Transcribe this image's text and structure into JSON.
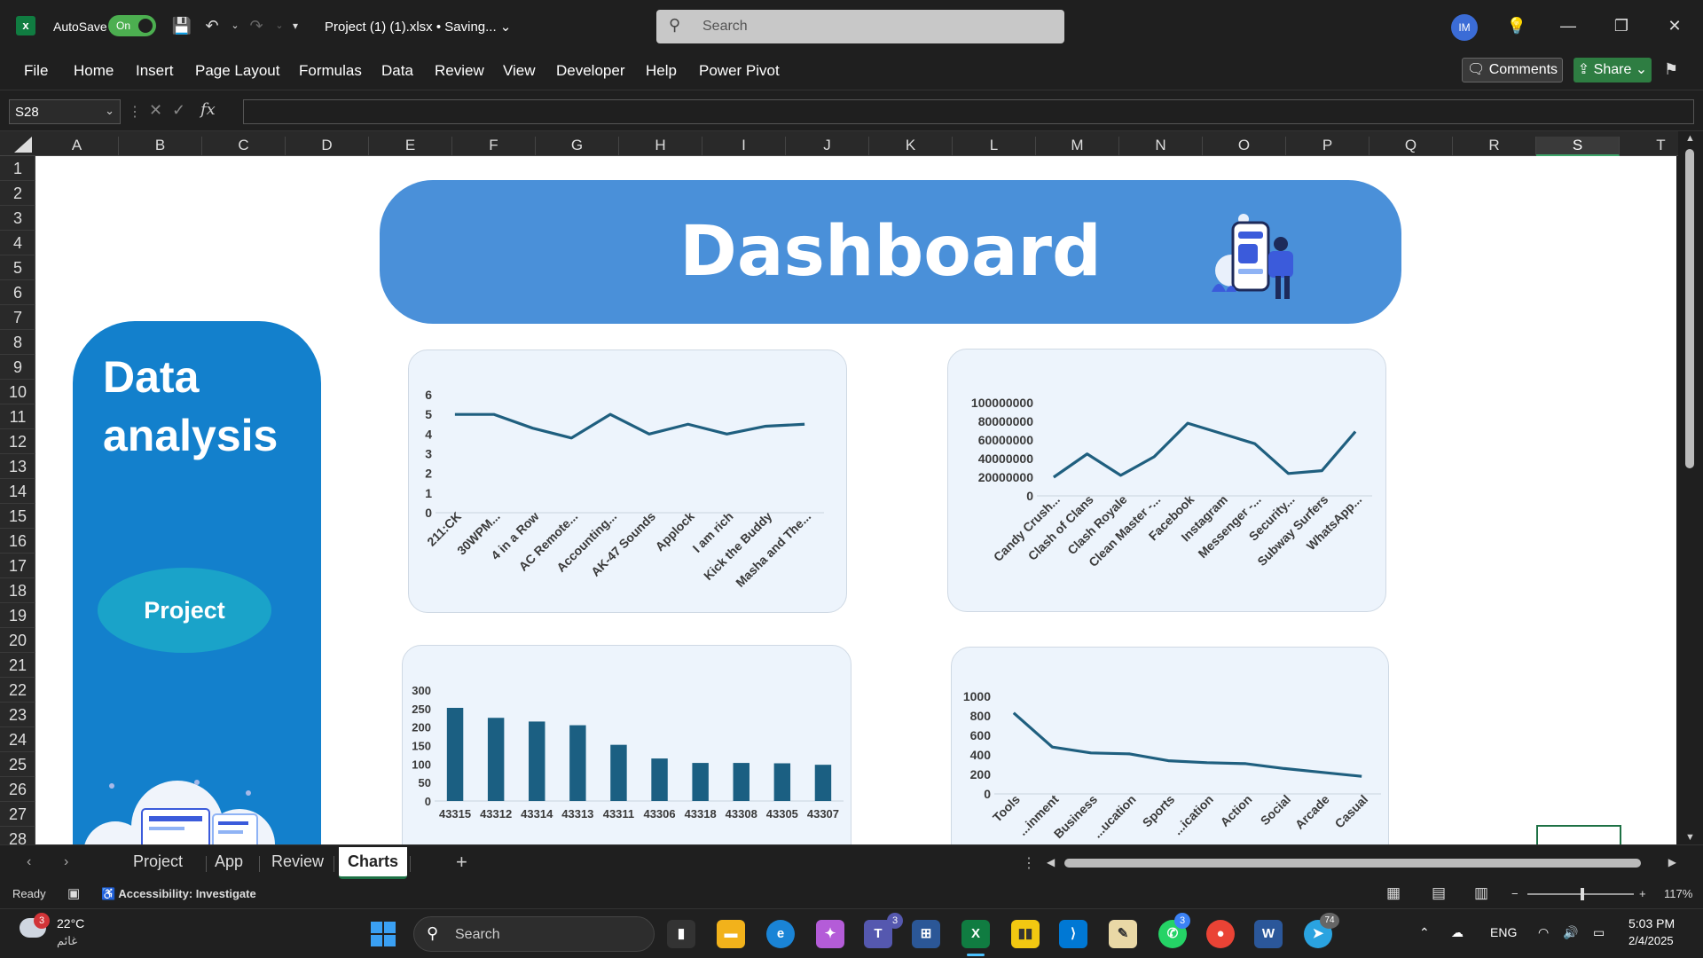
{
  "titlebar": {
    "autosave_label": "AutoSave",
    "autosave_state": "On",
    "doc_title": "Project (1) (1).xlsx • Saving... ⌄",
    "search_placeholder": "Search",
    "avatar_initials": "IM"
  },
  "menu": [
    "File",
    "Home",
    "Insert",
    "Page Layout",
    "Formulas",
    "Data",
    "Review",
    "View",
    "Developer",
    "Help",
    "Power Pivot"
  ],
  "menu_right": {
    "comments": "Comments",
    "share": "Share"
  },
  "formula_bar": {
    "name_box": "S28",
    "fx": "fx",
    "formula": ""
  },
  "columns": [
    "A",
    "B",
    "C",
    "D",
    "E",
    "F",
    "G",
    "H",
    "I",
    "J",
    "K",
    "L",
    "M",
    "N",
    "O",
    "P",
    "Q",
    "R",
    "S",
    "T"
  ],
  "selected_column": "S",
  "rows": [
    "1",
    "2",
    "3",
    "4",
    "5",
    "6",
    "7",
    "8",
    "9",
    "10",
    "11",
    "12",
    "13",
    "14",
    "15",
    "16",
    "17",
    "18",
    "19",
    "20",
    "21",
    "22",
    "23",
    "24",
    "25",
    "26",
    "27",
    "28"
  ],
  "dashboard": {
    "banner_title": "Dashboard",
    "side_title_line1": "Data",
    "side_title_line2": "analysis",
    "project_button": "Project"
  },
  "chart_data": [
    {
      "type": "line",
      "categories": [
        "211:CK",
        "30WPM...",
        "4 in a Row",
        "AC Remote...",
        "Accounting...",
        "AK-47 Sounds",
        "Applock",
        "I am rich",
        "Kick the Buddy",
        "Masha and The..."
      ],
      "values": [
        5.0,
        5.0,
        4.3,
        3.8,
        5.0,
        4.0,
        4.5,
        4.0,
        4.4,
        4.5
      ],
      "yticks": [
        "0",
        "1",
        "2",
        "3",
        "4",
        "5",
        "6"
      ],
      "ylim": [
        0,
        6
      ],
      "color": "#1f5f7f"
    },
    {
      "type": "line",
      "categories": [
        "Candy Crush...",
        "Clash of Clans",
        "Clash Royale",
        "Clean Master -...",
        "Facebook",
        "Instagram",
        "Messenger -...",
        "Security...",
        "Subway Surfers",
        "WhatsApp..."
      ],
      "values": [
        20000000,
        45000000,
        22000000,
        42000000,
        78000000,
        67000000,
        56000000,
        24000000,
        27000000,
        69000000
      ],
      "yticks": [
        "0",
        "20000000",
        "40000000",
        "60000000",
        "80000000",
        "100000000"
      ],
      "ylim": [
        0,
        100000000
      ],
      "color": "#1f5f7f"
    },
    {
      "type": "bar",
      "categories": [
        "43315",
        "43312",
        "43314",
        "43313",
        "43311",
        "43306",
        "43318",
        "43308",
        "43305",
        "43307"
      ],
      "values": [
        252,
        225,
        215,
        205,
        152,
        115,
        103,
        103,
        102,
        98
      ],
      "yticks": [
        "0",
        "50",
        "100",
        "150",
        "200",
        "250",
        "300"
      ],
      "ylim": [
        0,
        300
      ],
      "color": "#1b5f82"
    },
    {
      "type": "line",
      "categories": [
        "Tools",
        "...inment",
        "Business",
        "...ucation",
        "Sports",
        "...ication",
        "Action",
        "Social",
        "Arcade",
        "Casual"
      ],
      "values": [
        830,
        480,
        420,
        410,
        340,
        320,
        310,
        260,
        220,
        180
      ],
      "yticks": [
        "0",
        "200",
        "400",
        "600",
        "800",
        "1000"
      ],
      "ylim": [
        0,
        1000
      ],
      "color": "#1f5f7f"
    }
  ],
  "sheet_tabs": [
    "Project",
    "App",
    "Review",
    "Charts"
  ],
  "active_tab": "Charts",
  "status": {
    "ready": "Ready",
    "accessibility": "Accessibility: Investigate",
    "zoom": "117%"
  },
  "taskbar": {
    "weather_temp": "22°C",
    "weather_desc": "غائم",
    "weather_badge": "3",
    "search_placeholder": "Search",
    "lang": "ENG",
    "time": "5:03 PM",
    "date": "2/4/2025",
    "teams_badge": "3",
    "whatsapp_badge": "3",
    "telegram_badge": "74"
  }
}
